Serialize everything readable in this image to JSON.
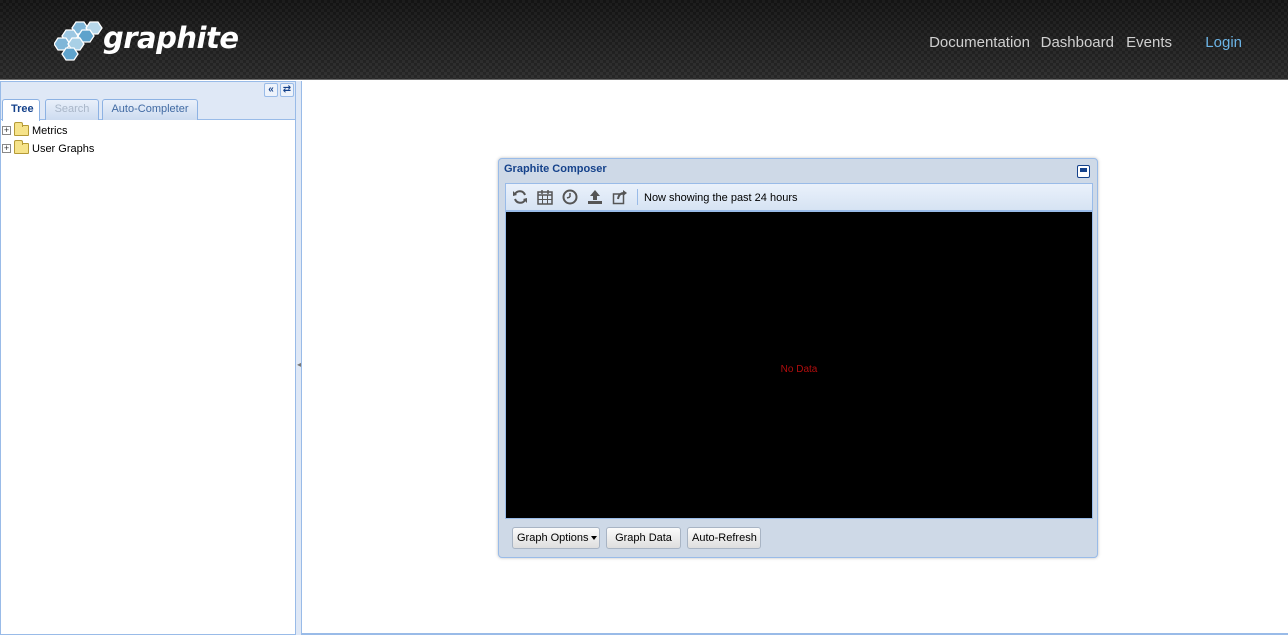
{
  "header": {
    "logo_text": "graphite",
    "nav": {
      "documentation": "Documentation",
      "dashboard": "Dashboard",
      "events": "Events",
      "login": "Login"
    }
  },
  "sidebar": {
    "collapse_icon": "«",
    "refresh_icon": "⇄",
    "tabs": [
      {
        "label": "Tree",
        "state": "active"
      },
      {
        "label": "Search",
        "state": "disabled"
      },
      {
        "label": "Auto-Completer",
        "state": "normal"
      }
    ],
    "tree": [
      {
        "label": "Metrics",
        "icon": "folder-icon"
      },
      {
        "label": "User Graphs",
        "icon": "folder-icon"
      }
    ]
  },
  "composer": {
    "title": "Graphite Composer",
    "toolbar_icons": [
      "refresh-icon",
      "calendar-icon",
      "clock-icon",
      "upload-icon",
      "share-icon"
    ],
    "time_range_text": "Now showing the past 24 hours",
    "no_data_text": "No Data",
    "buttons": {
      "graph_options": "Graph Options",
      "graph_data": "Graph Data",
      "auto_refresh": "Auto-Refresh"
    }
  },
  "colors": {
    "accent": "#15428b",
    "login_link": "#6cb4e6",
    "panel_border": "#99bbe8",
    "no_data": "#b10d0d"
  }
}
